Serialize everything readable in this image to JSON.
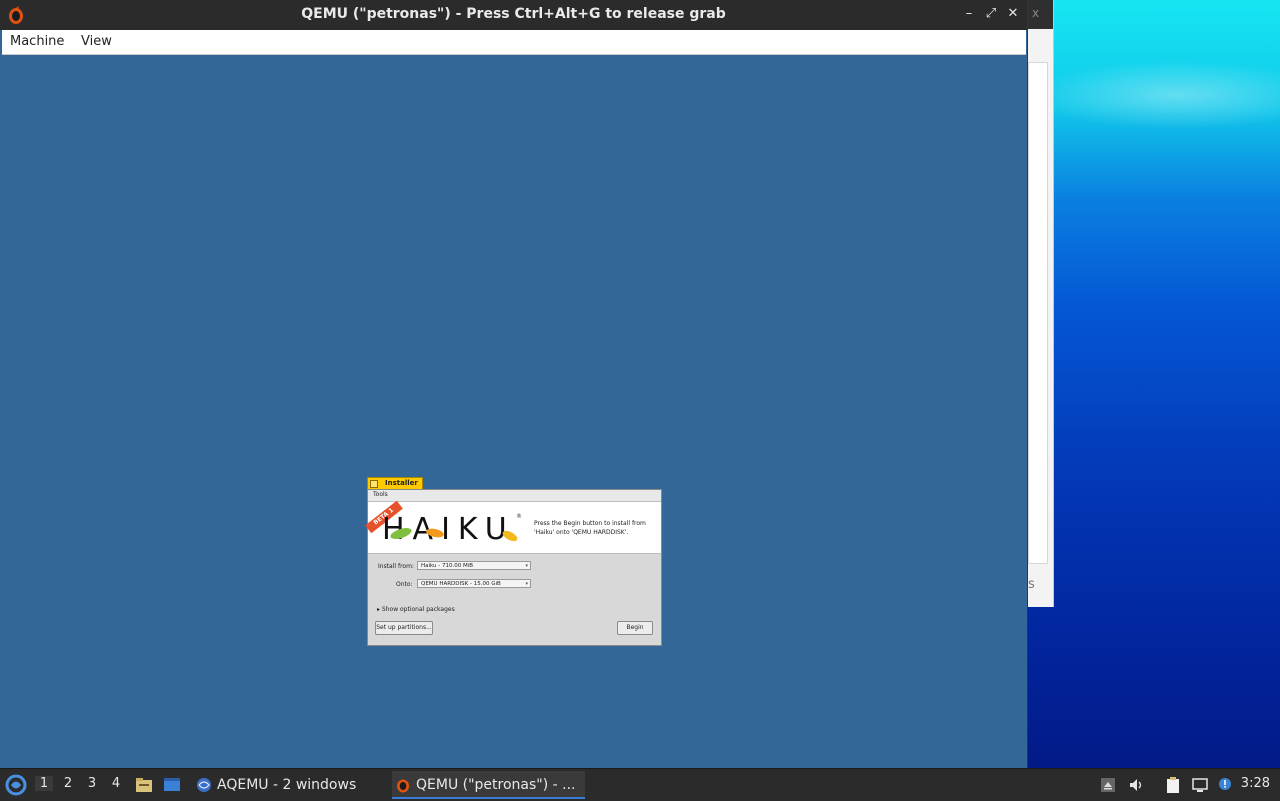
{
  "qemu_window": {
    "title": "QEMU (\"petronas\") - Press Ctrl+Alt+G to release grab",
    "menu": [
      "Machine",
      "View"
    ],
    "controls": {
      "minimize": "–",
      "maximize": "⤢",
      "close": "✕"
    }
  },
  "behind_window": {
    "text": "s",
    "close_hint": "x"
  },
  "installer": {
    "tab_title": "Installer",
    "menu_label": "Tools",
    "beta_badge": "BETA 1",
    "logo": "HAIKU",
    "registered": "®",
    "message": "Press the Begin button to install from 'Haiku' onto 'QEMU HARDDISK'.",
    "install_from_label": "Install from:",
    "install_from_value": "Haiku - 710.00 MiB",
    "onto_label": "Onto:",
    "onto_value": "QEMU HARDDISK - 15.00 GiB",
    "optional_packages": "▸ Show optional packages",
    "setup_partitions": "Set up partitions...",
    "begin": "Begin"
  },
  "taskbar": {
    "desktops": [
      "1",
      "2",
      "3",
      "4"
    ],
    "active_desktop": "1",
    "tasks": [
      {
        "label": "AQEMU - 2 windows",
        "active": false
      },
      {
        "label": "QEMU (\"petronas\") - ...",
        "active": true
      }
    ],
    "clock": "3:28"
  }
}
